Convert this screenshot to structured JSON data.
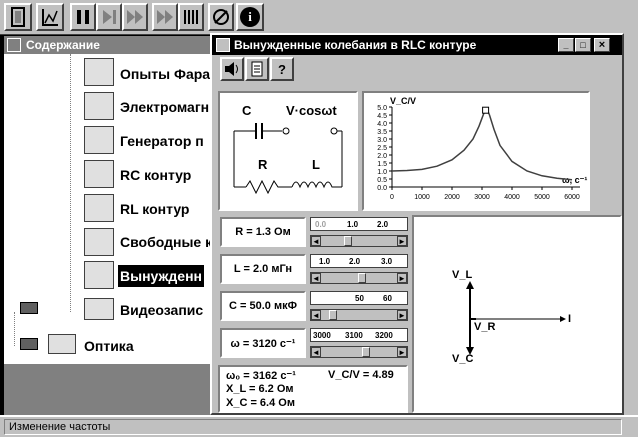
{
  "window": {
    "title": "Вынужденные колебания в RLC контуре",
    "minimize": "_",
    "maximize": "□",
    "close": "×"
  },
  "sidebar": {
    "title": "Содержание",
    "items": [
      {
        "label": "Опыты Фара"
      },
      {
        "label": "Электромагн"
      },
      {
        "label": "Генератор п"
      },
      {
        "label": "RC контур"
      },
      {
        "label": "RL контур"
      },
      {
        "label": "Свободные к"
      },
      {
        "label": "Вынужденн"
      },
      {
        "label": "Видеозапис"
      },
      {
        "label": "Оптика"
      }
    ]
  },
  "toolbar": {
    "help_icon": "i"
  },
  "inner_toolbar": {
    "help": "?"
  },
  "circuit": {
    "c_label": "C",
    "source_label": "V·cosωt",
    "r_label": "R",
    "l_label": "L"
  },
  "params": {
    "r_value": "R = 1.3 Ом",
    "r_ticks": [
      "0.0",
      "1.0",
      "2.0"
    ],
    "l_value": "L = 2.0 мГн",
    "l_ticks": [
      "1.0",
      "2.0",
      "3.0"
    ],
    "c_value": "C = 50.0 мкФ",
    "c_ticks": [
      "50",
      "60"
    ],
    "w_value": "ω = 3120 c⁻¹",
    "w_ticks": [
      "3000",
      "3100",
      "3200"
    ]
  },
  "slider_positions": {
    "r": 0.3,
    "l": 0.5,
    "c": 0.1,
    "w": 0.55
  },
  "results": {
    "w0": "ω₀ = 3162 c⁻¹",
    "ratio": "V_C/V = 4.89",
    "xl": "X_L = 6.2 Ом",
    "xc": "X_C = 6.4 Ом"
  },
  "status": {
    "text": "Изменение частоты"
  },
  "phasor": {
    "vl": "V_L",
    "vr": "V_R",
    "vc": "V_C",
    "i": "I"
  },
  "chart_data": {
    "type": "line",
    "title": "",
    "ylabel": "V_C/V",
    "xlabel": "ω, c⁻¹",
    "xlim": [
      0,
      6000
    ],
    "ylim": [
      0,
      5.0
    ],
    "xticks": [
      0,
      1000,
      2000,
      3000,
      4000,
      5000,
      6000
    ],
    "yticks": [
      0.0,
      0.5,
      1.0,
      1.5,
      2.0,
      2.5,
      3.0,
      3.5,
      4.0,
      4.5,
      5.0
    ],
    "x": [
      0,
      500,
      1000,
      1500,
      2000,
      2400,
      2700,
      2900,
      3000,
      3100,
      3162,
      3250,
      3400,
      3600,
      4000,
      4500,
      5000,
      5500,
      6000
    ],
    "y": [
      1.0,
      1.03,
      1.1,
      1.3,
      1.7,
      2.3,
      3.0,
      3.8,
      4.3,
      4.8,
      4.89,
      4.5,
      3.6,
      2.6,
      1.6,
      1.0,
      0.7,
      0.55,
      0.45
    ],
    "marker_x": 3120,
    "marker_y": 4.8
  }
}
